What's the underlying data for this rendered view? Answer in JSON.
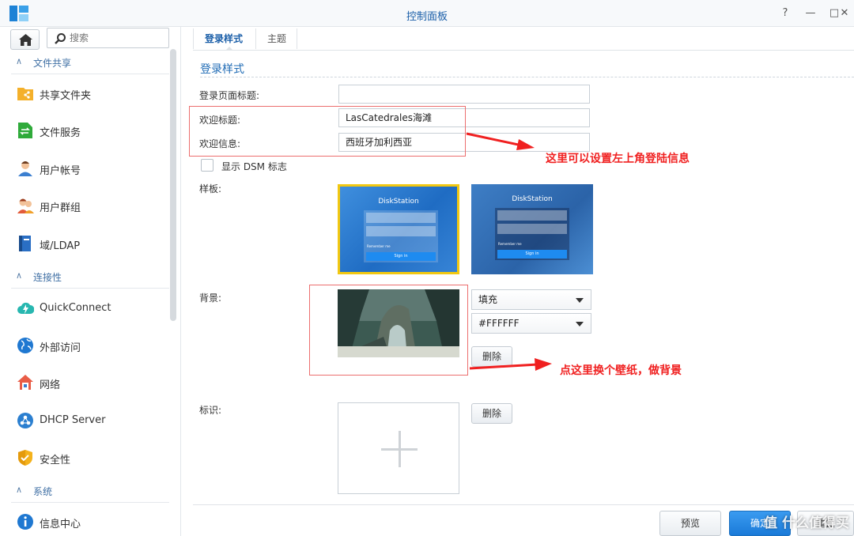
{
  "window": {
    "title": "控制面板",
    "controls": [
      "?",
      "—",
      "□",
      "✕"
    ]
  },
  "sidebar": {
    "search_placeholder": "搜索",
    "sections": [
      {
        "label": "文件共享",
        "items": [
          "共享文件夹",
          "文件服务",
          "用户帐号",
          "用户群组",
          "域/LDAP"
        ]
      },
      {
        "label": "连接性",
        "items": [
          "QuickConnect",
          "外部访问",
          "网络",
          "DHCP Server",
          "安全性"
        ]
      },
      {
        "label": "系统",
        "items": [
          "信息中心"
        ]
      }
    ]
  },
  "tabs": [
    {
      "label": "登录样式",
      "active": true
    },
    {
      "label": "主题",
      "active": false
    }
  ],
  "main": {
    "section_title": "登录样式",
    "fields": {
      "page_title_label": "登录页面标题:",
      "page_title_value": "",
      "welcome_title_label": "欢迎标题:",
      "welcome_title_value": "LasCatedrales海滩",
      "welcome_msg_label": "欢迎信息:",
      "welcome_msg_value": "西班牙加利西亚",
      "show_dsm_label": "显示 DSM 标志",
      "show_dsm_checked": false
    },
    "template": {
      "label": "样板:",
      "items": [
        {
          "title": "DiskStation",
          "remember": "Remember me",
          "signin": "Sign in",
          "selected": true
        },
        {
          "title": "DiskStation",
          "remember": "Remember me",
          "signin": "Sign in",
          "selected": false
        }
      ]
    },
    "background": {
      "label": "背景:",
      "fill_mode": "填充",
      "color": "#FFFFFF",
      "delete_label": "删除"
    },
    "logo": {
      "label": "标识:",
      "delete_label": "删除"
    },
    "footer": {
      "preview": "预览",
      "confirm": "确定",
      "reset": "重置"
    }
  },
  "annotations": {
    "note1": "这里可以设置左上角登陆信息",
    "note2": "点这里换个壁纸，做背景",
    "watermark": "值 什么值得买"
  },
  "colors": {
    "accent": "#1a5ea8",
    "annotation": "#f02020",
    "selected_template": "#f2c811"
  }
}
